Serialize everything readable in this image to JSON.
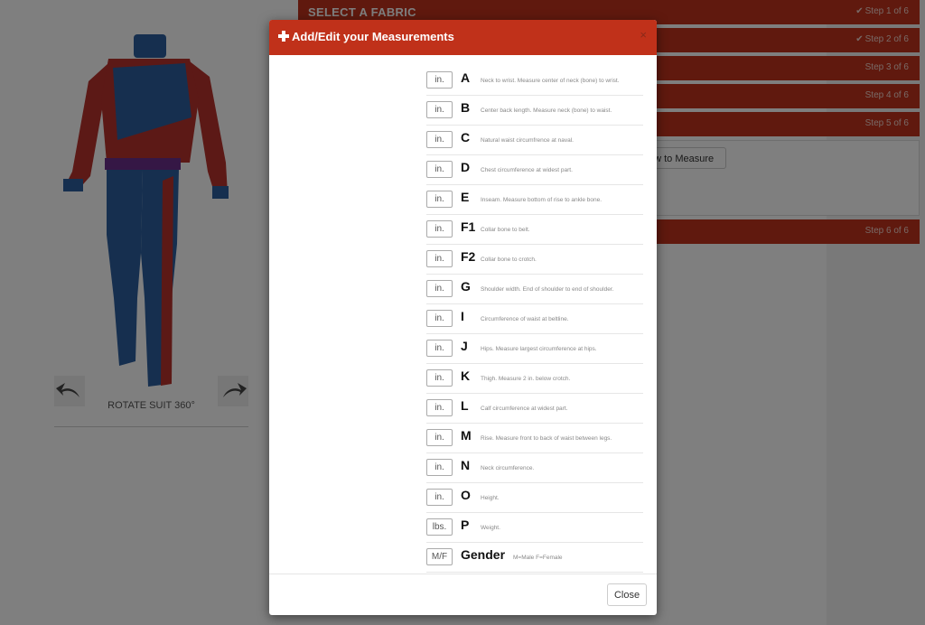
{
  "steps": [
    {
      "title": "SELECT A FABRIC",
      "num": "Step 1 of 6",
      "check": "✔"
    },
    {
      "title": "",
      "num": "Step 2 of 6",
      "check": "✔"
    },
    {
      "title": "",
      "num": "Step 3 of 6",
      "check": ""
    },
    {
      "title": "",
      "num": "Step 4 of 6",
      "check": ""
    },
    {
      "title": "",
      "num": "Step 5 of 6",
      "check": ""
    },
    {
      "title": "",
      "num": "Step 6 of 6",
      "check": ""
    }
  ],
  "step5": {
    "how_to_measure_label": "ow to Measure"
  },
  "suit": {
    "rotate_label": "ROTATE SUIT 360°"
  },
  "modal": {
    "title": "Add/Edit your Measurements",
    "close_x": "×",
    "close_button": "Close",
    "rows": [
      {
        "unit": "in.",
        "letter": "A",
        "desc": "Neck to wrist. Measure center of neck (bone) to wrist."
      },
      {
        "unit": "in.",
        "letter": "B",
        "desc": "Center back length. Measure neck (bone) to waist."
      },
      {
        "unit": "in.",
        "letter": "C",
        "desc": "Natural waist circumfrence at naval."
      },
      {
        "unit": "in.",
        "letter": "D",
        "desc": "Chest circumference at widest part."
      },
      {
        "unit": "in.",
        "letter": "E",
        "desc": "Inseam. Measure bottom of rise to ankle bone."
      },
      {
        "unit": "in.",
        "letter": "F1",
        "desc": "Collar bone to belt."
      },
      {
        "unit": "in.",
        "letter": "F2",
        "desc": "Collar bone to crotch."
      },
      {
        "unit": "in.",
        "letter": "G",
        "desc": "Shoulder width. End of shoulder to end of shoulder."
      },
      {
        "unit": "in.",
        "letter": "I",
        "desc": "Circumference of waist at beltline."
      },
      {
        "unit": "in.",
        "letter": "J",
        "desc": "Hips. Measure largest circumference at hips."
      },
      {
        "unit": "in.",
        "letter": "K",
        "desc": "Thigh. Measure 2 in. below crotch."
      },
      {
        "unit": "in.",
        "letter": "L",
        "desc": "Calf circumference at widest part."
      },
      {
        "unit": "in.",
        "letter": "M",
        "desc": "Rise. Measure front to back of waist between legs."
      },
      {
        "unit": "in.",
        "letter": "N",
        "desc": "Neck circumference."
      },
      {
        "unit": "in.",
        "letter": "O",
        "desc": "Height."
      },
      {
        "unit": "lbs.",
        "letter": "P",
        "desc": "Weight."
      },
      {
        "unit": "M/F",
        "letter": "Gender",
        "desc": "M=Male F=Female"
      }
    ]
  },
  "colors": {
    "accent": "#c0311a",
    "suit_red": "#b8322c",
    "suit_blue": "#2c5f9e"
  },
  "icons": {
    "plus": "plus-icon",
    "close": "close-icon",
    "check": "check-icon",
    "rotate_left": "rotate-left-icon",
    "rotate_right": "rotate-right-icon"
  }
}
